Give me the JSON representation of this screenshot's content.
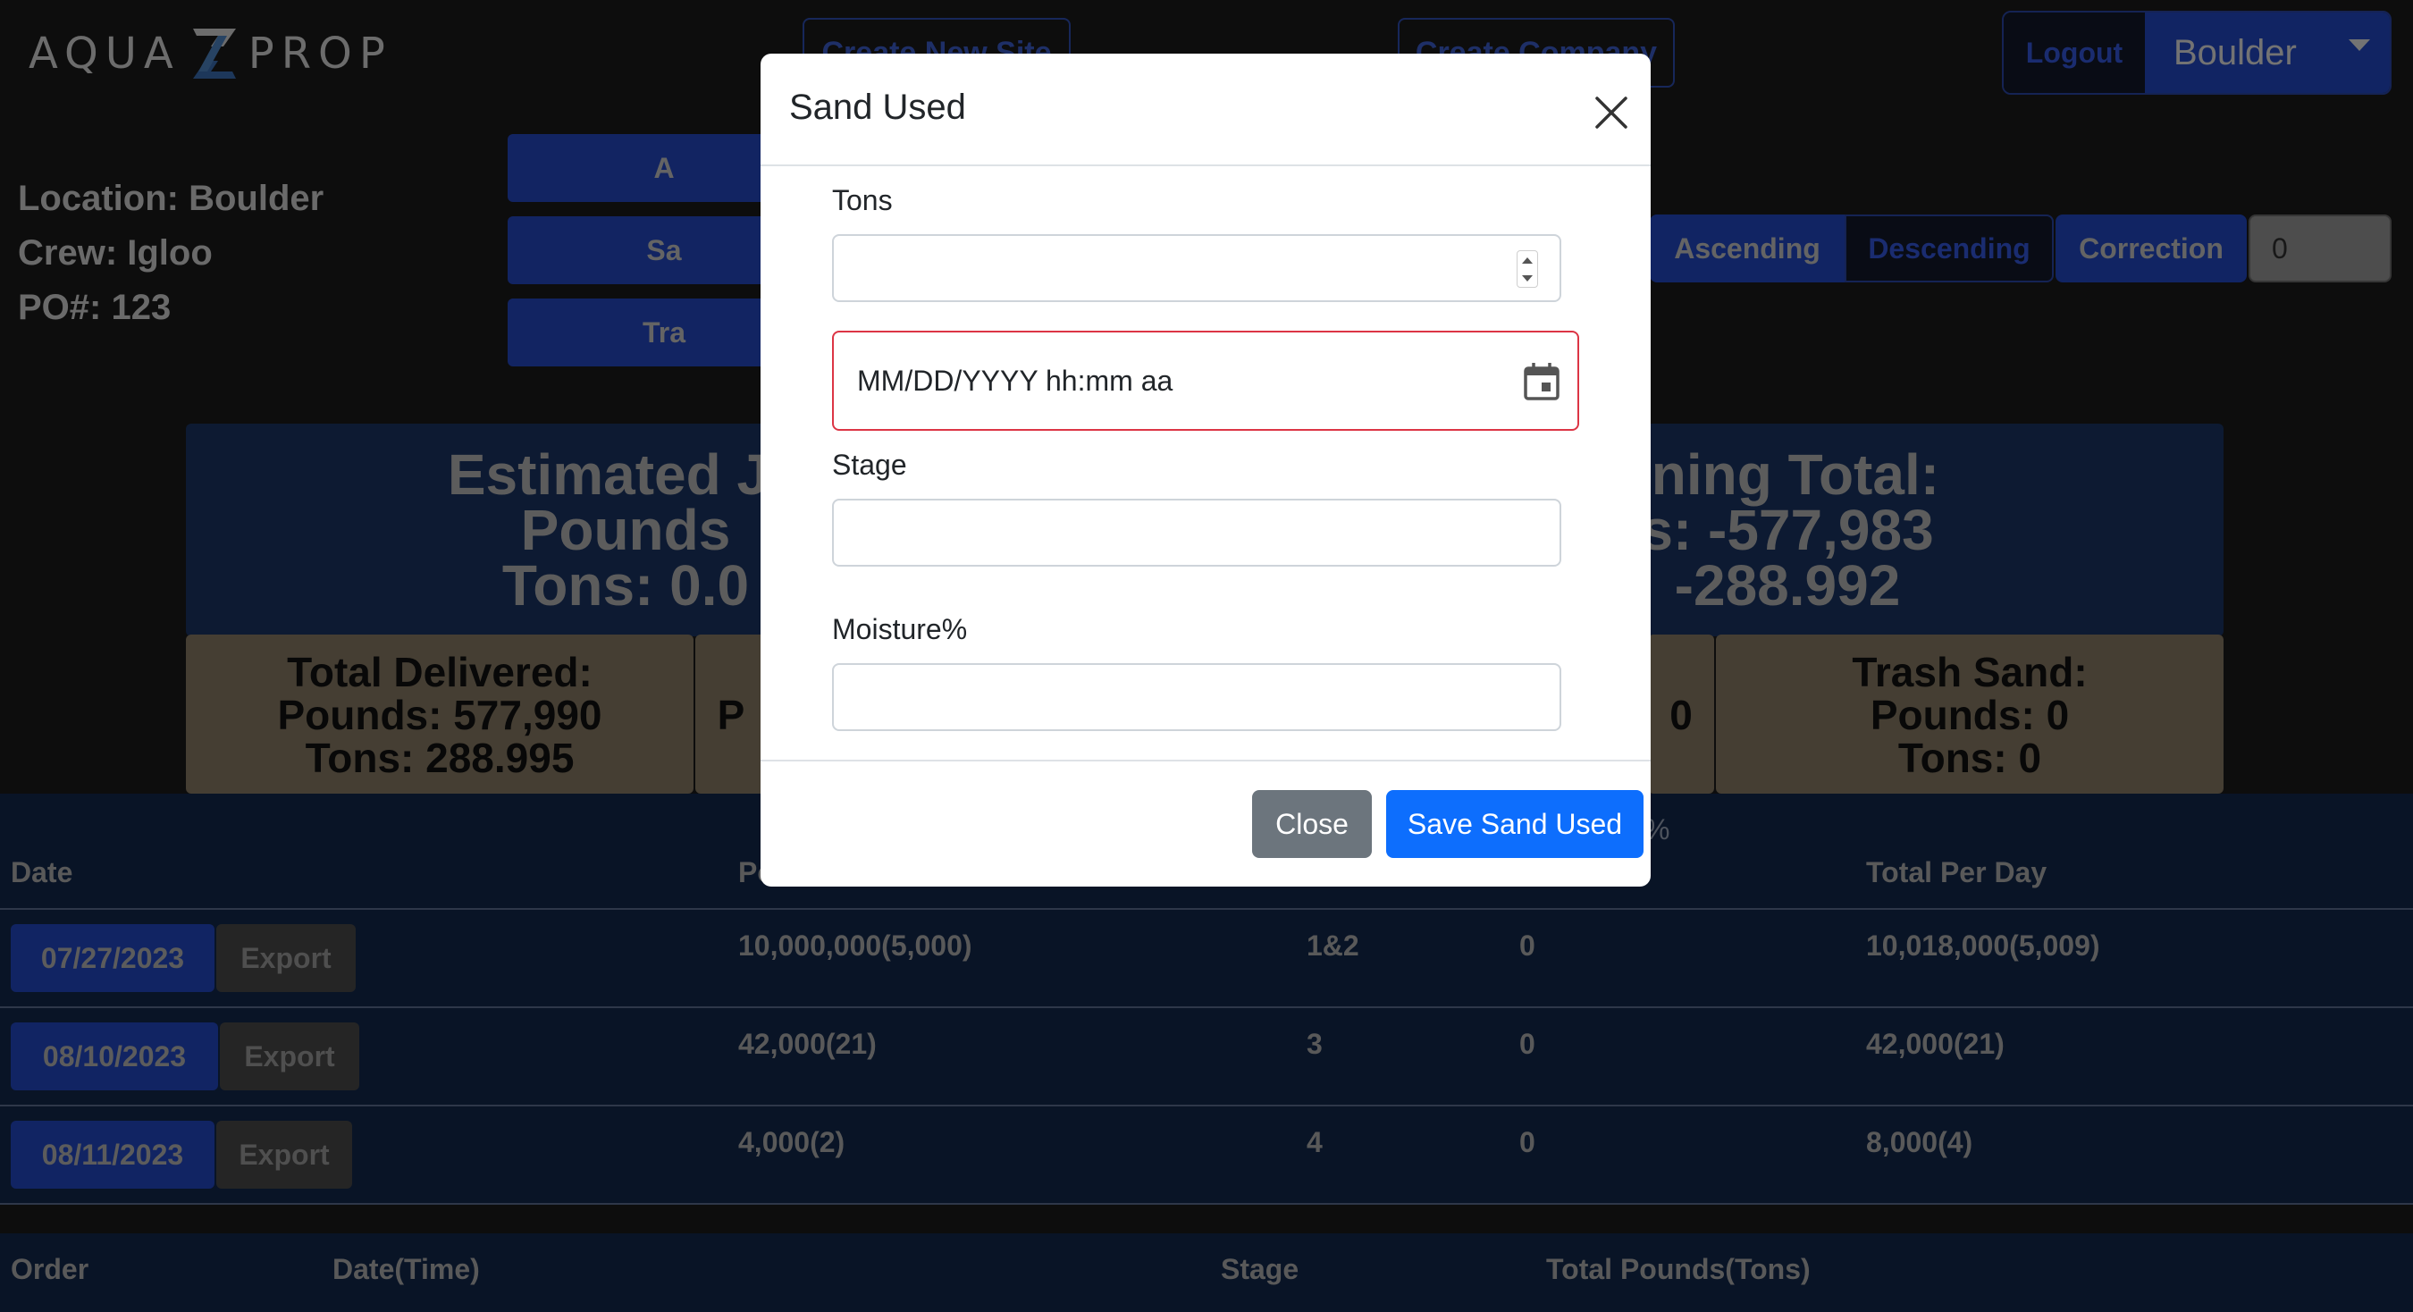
{
  "header": {
    "brand_left": "AQUA",
    "brand_right": "PROP",
    "create_site_label": "Create New Site",
    "create_company_label": "Create Company",
    "logout_label": "Logout",
    "site_selected": "Boulder"
  },
  "info": {
    "location": "Location: Boulder",
    "crew": "Crew: Igloo",
    "po": "PO#: 123"
  },
  "actions": {
    "btn1_label": "A",
    "btn2_label": "Sa",
    "btn3_label": "Tra"
  },
  "sort": {
    "ascending_label": "Ascending",
    "descending_label": "Descending",
    "correction_label": "Correction",
    "correction_value": "0"
  },
  "banner": {
    "left_line1": "Estimated Jo",
    "left_line2": "Pounds",
    "left_line3": "Tons: 0.0",
    "right_line1": "ining Total:",
    "right_line2": "s: -577,983",
    "right_line3": "-288.992"
  },
  "cards": {
    "delivered": [
      "Total Delivered:",
      "Pounds: 577,990",
      "Tons: 288.995"
    ],
    "second_partial": "P",
    "third_partial": "0",
    "trash": [
      "Trash Sand:",
      "Pounds: 0",
      "Tons: 0"
    ]
  },
  "table": {
    "percent_fragment": "%",
    "headers": {
      "date": "Date",
      "pounds": "Po",
      "total_per_day": "Total Per Day"
    },
    "export_label": "Export",
    "rows": [
      {
        "date": "07/27/2023",
        "pounds": "10,000,000(5,000)",
        "stage": "1&2",
        "moisture": "0",
        "total": "10,018,000(5,009)"
      },
      {
        "date": "08/10/2023",
        "pounds": "42,000(21)",
        "stage": "3",
        "moisture": "0",
        "total": "42,000(21)"
      },
      {
        "date": "08/11/2023",
        "pounds": "4,000(2)",
        "stage": "4",
        "moisture": "0",
        "total": "8,000(4)"
      }
    ]
  },
  "orders": {
    "headers": [
      "Order",
      "Date(Time)",
      "Stage",
      "Total Pounds(Tons)"
    ]
  },
  "modal": {
    "title": "Sand Used",
    "tons_label": "Tons",
    "tons_value": "",
    "date_placeholder": "MM/DD/YYYY hh:mm aa",
    "stage_label": "Stage",
    "stage_value": "",
    "moisture_label": "Moisture%",
    "moisture_value": "",
    "close_label": "Close",
    "save_label": "Save Sand Used"
  },
  "colors": {
    "primary": "#0d6efd",
    "secondary": "#6c757d",
    "danger": "#dc3545",
    "nav_blue": "#2248c7",
    "banner": "#1a3565",
    "card": "#8a7d66"
  }
}
